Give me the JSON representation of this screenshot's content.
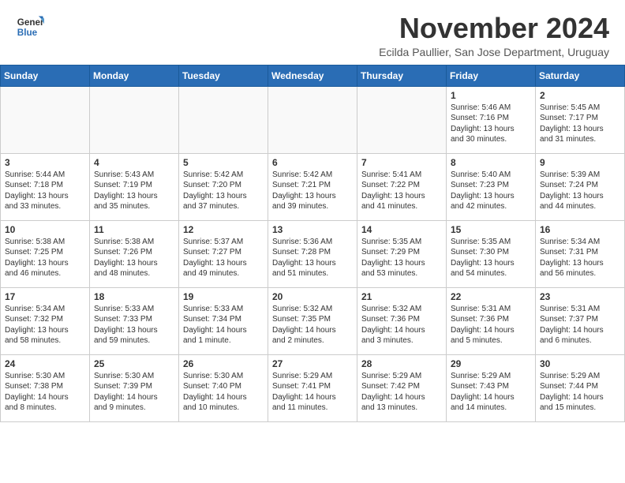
{
  "header": {
    "logo_line1": "General",
    "logo_line2": "Blue",
    "month_title": "November 2024",
    "subtitle": "Ecilda Paullier, San Jose Department, Uruguay"
  },
  "days_of_week": [
    "Sunday",
    "Monday",
    "Tuesday",
    "Wednesday",
    "Thursday",
    "Friday",
    "Saturday"
  ],
  "weeks": [
    [
      {
        "day": "",
        "info": ""
      },
      {
        "day": "",
        "info": ""
      },
      {
        "day": "",
        "info": ""
      },
      {
        "day": "",
        "info": ""
      },
      {
        "day": "",
        "info": ""
      },
      {
        "day": "1",
        "info": "Sunrise: 5:46 AM\nSunset: 7:16 PM\nDaylight: 13 hours\nand 30 minutes."
      },
      {
        "day": "2",
        "info": "Sunrise: 5:45 AM\nSunset: 7:17 PM\nDaylight: 13 hours\nand 31 minutes."
      }
    ],
    [
      {
        "day": "3",
        "info": "Sunrise: 5:44 AM\nSunset: 7:18 PM\nDaylight: 13 hours\nand 33 minutes."
      },
      {
        "day": "4",
        "info": "Sunrise: 5:43 AM\nSunset: 7:19 PM\nDaylight: 13 hours\nand 35 minutes."
      },
      {
        "day": "5",
        "info": "Sunrise: 5:42 AM\nSunset: 7:20 PM\nDaylight: 13 hours\nand 37 minutes."
      },
      {
        "day": "6",
        "info": "Sunrise: 5:42 AM\nSunset: 7:21 PM\nDaylight: 13 hours\nand 39 minutes."
      },
      {
        "day": "7",
        "info": "Sunrise: 5:41 AM\nSunset: 7:22 PM\nDaylight: 13 hours\nand 41 minutes."
      },
      {
        "day": "8",
        "info": "Sunrise: 5:40 AM\nSunset: 7:23 PM\nDaylight: 13 hours\nand 42 minutes."
      },
      {
        "day": "9",
        "info": "Sunrise: 5:39 AM\nSunset: 7:24 PM\nDaylight: 13 hours\nand 44 minutes."
      }
    ],
    [
      {
        "day": "10",
        "info": "Sunrise: 5:38 AM\nSunset: 7:25 PM\nDaylight: 13 hours\nand 46 minutes."
      },
      {
        "day": "11",
        "info": "Sunrise: 5:38 AM\nSunset: 7:26 PM\nDaylight: 13 hours\nand 48 minutes."
      },
      {
        "day": "12",
        "info": "Sunrise: 5:37 AM\nSunset: 7:27 PM\nDaylight: 13 hours\nand 49 minutes."
      },
      {
        "day": "13",
        "info": "Sunrise: 5:36 AM\nSunset: 7:28 PM\nDaylight: 13 hours\nand 51 minutes."
      },
      {
        "day": "14",
        "info": "Sunrise: 5:35 AM\nSunset: 7:29 PM\nDaylight: 13 hours\nand 53 minutes."
      },
      {
        "day": "15",
        "info": "Sunrise: 5:35 AM\nSunset: 7:30 PM\nDaylight: 13 hours\nand 54 minutes."
      },
      {
        "day": "16",
        "info": "Sunrise: 5:34 AM\nSunset: 7:31 PM\nDaylight: 13 hours\nand 56 minutes."
      }
    ],
    [
      {
        "day": "17",
        "info": "Sunrise: 5:34 AM\nSunset: 7:32 PM\nDaylight: 13 hours\nand 58 minutes."
      },
      {
        "day": "18",
        "info": "Sunrise: 5:33 AM\nSunset: 7:33 PM\nDaylight: 13 hours\nand 59 minutes."
      },
      {
        "day": "19",
        "info": "Sunrise: 5:33 AM\nSunset: 7:34 PM\nDaylight: 14 hours\nand 1 minute."
      },
      {
        "day": "20",
        "info": "Sunrise: 5:32 AM\nSunset: 7:35 PM\nDaylight: 14 hours\nand 2 minutes."
      },
      {
        "day": "21",
        "info": "Sunrise: 5:32 AM\nSunset: 7:36 PM\nDaylight: 14 hours\nand 3 minutes."
      },
      {
        "day": "22",
        "info": "Sunrise: 5:31 AM\nSunset: 7:36 PM\nDaylight: 14 hours\nand 5 minutes."
      },
      {
        "day": "23",
        "info": "Sunrise: 5:31 AM\nSunset: 7:37 PM\nDaylight: 14 hours\nand 6 minutes."
      }
    ],
    [
      {
        "day": "24",
        "info": "Sunrise: 5:30 AM\nSunset: 7:38 PM\nDaylight: 14 hours\nand 8 minutes."
      },
      {
        "day": "25",
        "info": "Sunrise: 5:30 AM\nSunset: 7:39 PM\nDaylight: 14 hours\nand 9 minutes."
      },
      {
        "day": "26",
        "info": "Sunrise: 5:30 AM\nSunset: 7:40 PM\nDaylight: 14 hours\nand 10 minutes."
      },
      {
        "day": "27",
        "info": "Sunrise: 5:29 AM\nSunset: 7:41 PM\nDaylight: 14 hours\nand 11 minutes."
      },
      {
        "day": "28",
        "info": "Sunrise: 5:29 AM\nSunset: 7:42 PM\nDaylight: 14 hours\nand 13 minutes."
      },
      {
        "day": "29",
        "info": "Sunrise: 5:29 AM\nSunset: 7:43 PM\nDaylight: 14 hours\nand 14 minutes."
      },
      {
        "day": "30",
        "info": "Sunrise: 5:29 AM\nSunset: 7:44 PM\nDaylight: 14 hours\nand 15 minutes."
      }
    ]
  ]
}
